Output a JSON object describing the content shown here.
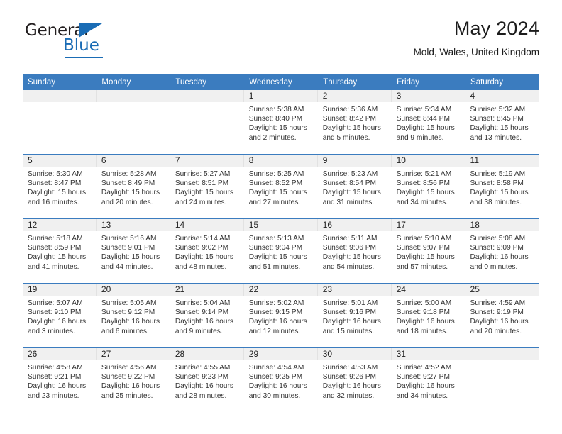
{
  "brand": {
    "word1": "General",
    "word2": "Blue",
    "accent_color": "#1a6cb5",
    "triangle_icon": "triangle-icon"
  },
  "header": {
    "title": "May 2024",
    "location": "Mold, Wales, United Kingdom"
  },
  "calendar": {
    "header_bg": "#3b7cbf",
    "daynum_bg": "#f0f0f0",
    "weekdays": [
      "Sunday",
      "Monday",
      "Tuesday",
      "Wednesday",
      "Thursday",
      "Friday",
      "Saturday"
    ],
    "labels": {
      "sunrise": "Sunrise:",
      "sunset": "Sunset:",
      "daylight": "Daylight:"
    },
    "weeks": [
      [
        {
          "day": ""
        },
        {
          "day": ""
        },
        {
          "day": ""
        },
        {
          "day": "1",
          "sunrise": "Sunrise: 5:38 AM",
          "sunset": "Sunset: 8:40 PM",
          "daylight": "Daylight: 15 hours and 2 minutes."
        },
        {
          "day": "2",
          "sunrise": "Sunrise: 5:36 AM",
          "sunset": "Sunset: 8:42 PM",
          "daylight": "Daylight: 15 hours and 5 minutes."
        },
        {
          "day": "3",
          "sunrise": "Sunrise: 5:34 AM",
          "sunset": "Sunset: 8:44 PM",
          "daylight": "Daylight: 15 hours and 9 minutes."
        },
        {
          "day": "4",
          "sunrise": "Sunrise: 5:32 AM",
          "sunset": "Sunset: 8:45 PM",
          "daylight": "Daylight: 15 hours and 13 minutes."
        }
      ],
      [
        {
          "day": "5",
          "sunrise": "Sunrise: 5:30 AM",
          "sunset": "Sunset: 8:47 PM",
          "daylight": "Daylight: 15 hours and 16 minutes."
        },
        {
          "day": "6",
          "sunrise": "Sunrise: 5:28 AM",
          "sunset": "Sunset: 8:49 PM",
          "daylight": "Daylight: 15 hours and 20 minutes."
        },
        {
          "day": "7",
          "sunrise": "Sunrise: 5:27 AM",
          "sunset": "Sunset: 8:51 PM",
          "daylight": "Daylight: 15 hours and 24 minutes."
        },
        {
          "day": "8",
          "sunrise": "Sunrise: 5:25 AM",
          "sunset": "Sunset: 8:52 PM",
          "daylight": "Daylight: 15 hours and 27 minutes."
        },
        {
          "day": "9",
          "sunrise": "Sunrise: 5:23 AM",
          "sunset": "Sunset: 8:54 PM",
          "daylight": "Daylight: 15 hours and 31 minutes."
        },
        {
          "day": "10",
          "sunrise": "Sunrise: 5:21 AM",
          "sunset": "Sunset: 8:56 PM",
          "daylight": "Daylight: 15 hours and 34 minutes."
        },
        {
          "day": "11",
          "sunrise": "Sunrise: 5:19 AM",
          "sunset": "Sunset: 8:58 PM",
          "daylight": "Daylight: 15 hours and 38 minutes."
        }
      ],
      [
        {
          "day": "12",
          "sunrise": "Sunrise: 5:18 AM",
          "sunset": "Sunset: 8:59 PM",
          "daylight": "Daylight: 15 hours and 41 minutes."
        },
        {
          "day": "13",
          "sunrise": "Sunrise: 5:16 AM",
          "sunset": "Sunset: 9:01 PM",
          "daylight": "Daylight: 15 hours and 44 minutes."
        },
        {
          "day": "14",
          "sunrise": "Sunrise: 5:14 AM",
          "sunset": "Sunset: 9:02 PM",
          "daylight": "Daylight: 15 hours and 48 minutes."
        },
        {
          "day": "15",
          "sunrise": "Sunrise: 5:13 AM",
          "sunset": "Sunset: 9:04 PM",
          "daylight": "Daylight: 15 hours and 51 minutes."
        },
        {
          "day": "16",
          "sunrise": "Sunrise: 5:11 AM",
          "sunset": "Sunset: 9:06 PM",
          "daylight": "Daylight: 15 hours and 54 minutes."
        },
        {
          "day": "17",
          "sunrise": "Sunrise: 5:10 AM",
          "sunset": "Sunset: 9:07 PM",
          "daylight": "Daylight: 15 hours and 57 minutes."
        },
        {
          "day": "18",
          "sunrise": "Sunrise: 5:08 AM",
          "sunset": "Sunset: 9:09 PM",
          "daylight": "Daylight: 16 hours and 0 minutes."
        }
      ],
      [
        {
          "day": "19",
          "sunrise": "Sunrise: 5:07 AM",
          "sunset": "Sunset: 9:10 PM",
          "daylight": "Daylight: 16 hours and 3 minutes."
        },
        {
          "day": "20",
          "sunrise": "Sunrise: 5:05 AM",
          "sunset": "Sunset: 9:12 PM",
          "daylight": "Daylight: 16 hours and 6 minutes."
        },
        {
          "day": "21",
          "sunrise": "Sunrise: 5:04 AM",
          "sunset": "Sunset: 9:14 PM",
          "daylight": "Daylight: 16 hours and 9 minutes."
        },
        {
          "day": "22",
          "sunrise": "Sunrise: 5:02 AM",
          "sunset": "Sunset: 9:15 PM",
          "daylight": "Daylight: 16 hours and 12 minutes."
        },
        {
          "day": "23",
          "sunrise": "Sunrise: 5:01 AM",
          "sunset": "Sunset: 9:16 PM",
          "daylight": "Daylight: 16 hours and 15 minutes."
        },
        {
          "day": "24",
          "sunrise": "Sunrise: 5:00 AM",
          "sunset": "Sunset: 9:18 PM",
          "daylight": "Daylight: 16 hours and 18 minutes."
        },
        {
          "day": "25",
          "sunrise": "Sunrise: 4:59 AM",
          "sunset": "Sunset: 9:19 PM",
          "daylight": "Daylight: 16 hours and 20 minutes."
        }
      ],
      [
        {
          "day": "26",
          "sunrise": "Sunrise: 4:58 AM",
          "sunset": "Sunset: 9:21 PM",
          "daylight": "Daylight: 16 hours and 23 minutes."
        },
        {
          "day": "27",
          "sunrise": "Sunrise: 4:56 AM",
          "sunset": "Sunset: 9:22 PM",
          "daylight": "Daylight: 16 hours and 25 minutes."
        },
        {
          "day": "28",
          "sunrise": "Sunrise: 4:55 AM",
          "sunset": "Sunset: 9:23 PM",
          "daylight": "Daylight: 16 hours and 28 minutes."
        },
        {
          "day": "29",
          "sunrise": "Sunrise: 4:54 AM",
          "sunset": "Sunset: 9:25 PM",
          "daylight": "Daylight: 16 hours and 30 minutes."
        },
        {
          "day": "30",
          "sunrise": "Sunrise: 4:53 AM",
          "sunset": "Sunset: 9:26 PM",
          "daylight": "Daylight: 16 hours and 32 minutes."
        },
        {
          "day": "31",
          "sunrise": "Sunrise: 4:52 AM",
          "sunset": "Sunset: 9:27 PM",
          "daylight": "Daylight: 16 hours and 34 minutes."
        },
        {
          "day": ""
        }
      ]
    ]
  }
}
